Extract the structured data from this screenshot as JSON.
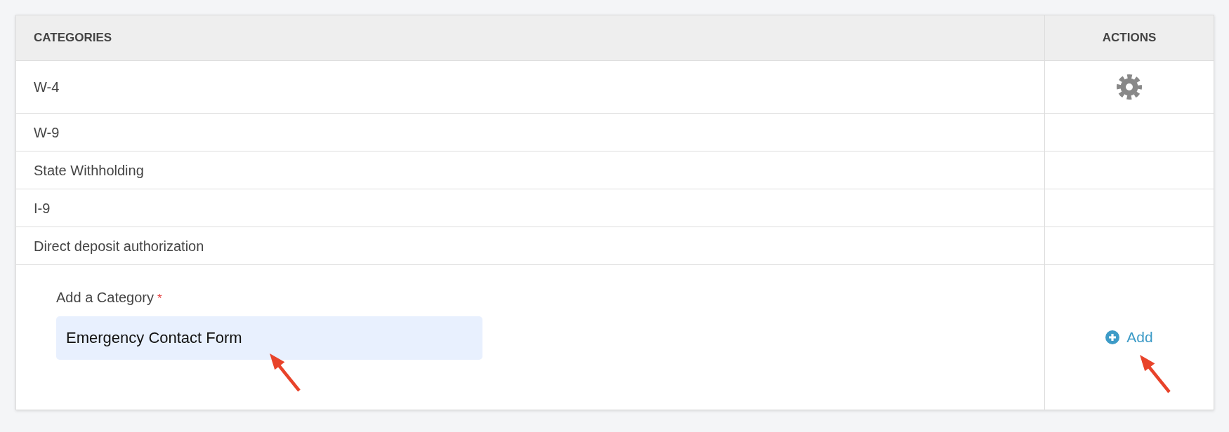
{
  "table": {
    "columns": [
      "CATEGORIES",
      "ACTIONS"
    ],
    "rows": [
      {
        "category": "W-4",
        "settings": true
      },
      {
        "category": "W-9",
        "settings": false
      },
      {
        "category": "State Withholding",
        "settings": false
      },
      {
        "category": "I-9",
        "settings": false
      },
      {
        "category": "Direct deposit authorization",
        "settings": false
      }
    ]
  },
  "add_form": {
    "label": "Add a Category",
    "required": true,
    "required_mark": "*",
    "value": "Emergency Contact Form",
    "button": "Add"
  }
}
